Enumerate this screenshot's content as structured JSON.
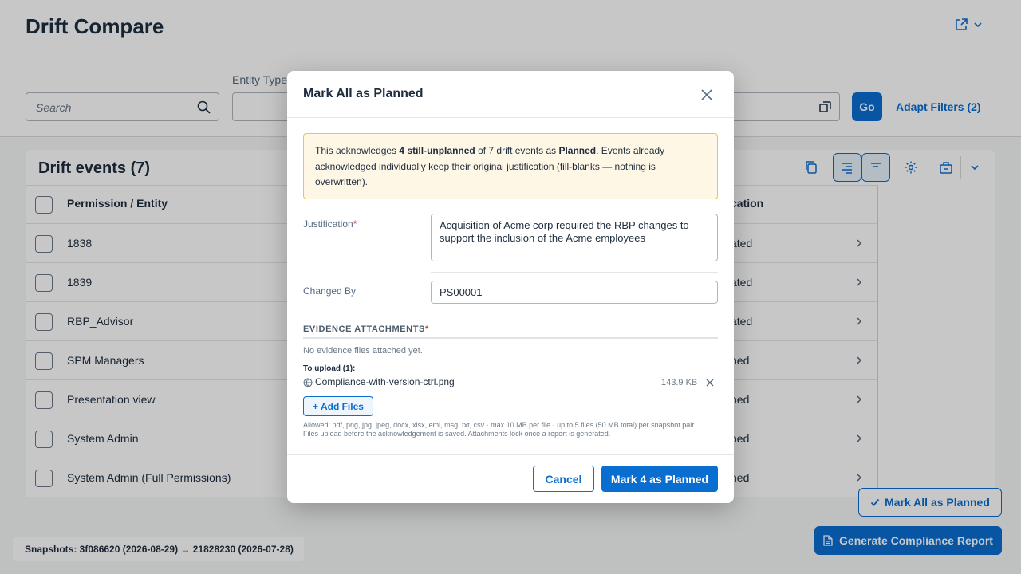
{
  "page": {
    "title": "Drift Compare",
    "filters": {
      "search_placeholder": "Search",
      "entity_type_label": "Entity Type",
      "go_label": "Go",
      "adapt_filters_label": "Adapt Filters (2)"
    },
    "table": {
      "title": "Drift events (7)",
      "headers": {
        "entity": "Permission / Entity",
        "classification": "cation"
      },
      "rows": [
        {
          "name": "1838",
          "status": "ated"
        },
        {
          "name": "1839",
          "status": "ated"
        },
        {
          "name": "RBP_Advisor",
          "status": "ated"
        },
        {
          "name": "SPM Managers",
          "status": "ned"
        },
        {
          "name": "Presentation view",
          "status": "ned"
        },
        {
          "name": "System Admin",
          "status": "ned"
        },
        {
          "name": "System Admin (Full Permissions)",
          "status": "ned"
        }
      ]
    },
    "footer": {
      "mark_all_label": "Mark All as Planned",
      "generate_label": "Generate Compliance Report",
      "snapshots": "Snapshots: 3f086620 (2026-08-29) → 21828230 (2026-07-28)"
    }
  },
  "dialog": {
    "title": "Mark All as Planned",
    "warning": {
      "p1": "This acknowledges ",
      "b1": "4 still-unplanned",
      "p2": " of 7 drift events as ",
      "b2": "Planned",
      "p3": ". Events already acknowledged individually keep their original justification (fill-blanks — nothing is overwritten)."
    },
    "justification_label": "Justification",
    "justification_value": "Acquisition of Acme corp required the RBP changes to support the inclusion of the Acme employees",
    "changed_by_label": "Changed By",
    "changed_by_value": "PS00001",
    "evidence_title": "EVIDENCE ATTACHMENTS",
    "no_files": "No evidence files attached yet.",
    "to_upload": "To upload (1):",
    "file": {
      "name": "Compliance-with-version-ctrl.png",
      "size": "143.9 KB"
    },
    "add_files_label": "+ Add Files",
    "allowed_text": "Allowed: pdf, png, jpg, jpeg, docx, xlsx, eml, msg, txt, csv · max 10 MB per file · up to 5 files (50 MB total) per snapshot pair. Files upload before the acknowledgement is saved. Attachments lock once a report is generated.",
    "cancel_label": "Cancel",
    "confirm_label": "Mark 4 as Planned",
    "required_mark": "*"
  },
  "colors": {
    "accent": "#0a6ed1",
    "warning_bg": "#fef7e6",
    "warning_border": "#f0c05a",
    "required": "#d92a2a"
  }
}
